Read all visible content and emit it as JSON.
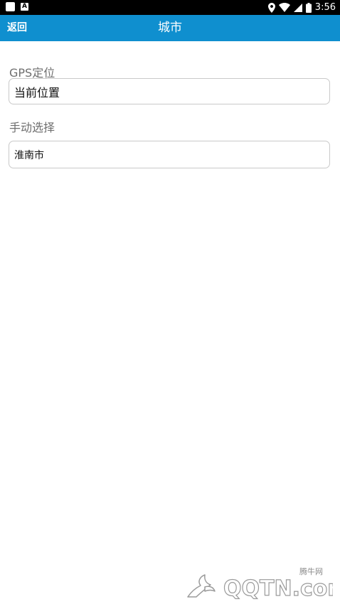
{
  "status_bar": {
    "time": "3:56",
    "left_icons": [
      "notification-icon",
      "text-a-icon"
    ],
    "right_icons": [
      "location-icon",
      "wifi-icon",
      "signal-icon",
      "battery-icon"
    ]
  },
  "header": {
    "back_label": "返回",
    "title": "城市",
    "color": "#0f8fcf"
  },
  "gps": {
    "label": "GPS定位",
    "value": "当前位置"
  },
  "manual": {
    "label": "手动选择",
    "value": "淮南市"
  },
  "watermark": {
    "site_name": "腾牛网",
    "brand": "QQTN.com"
  }
}
